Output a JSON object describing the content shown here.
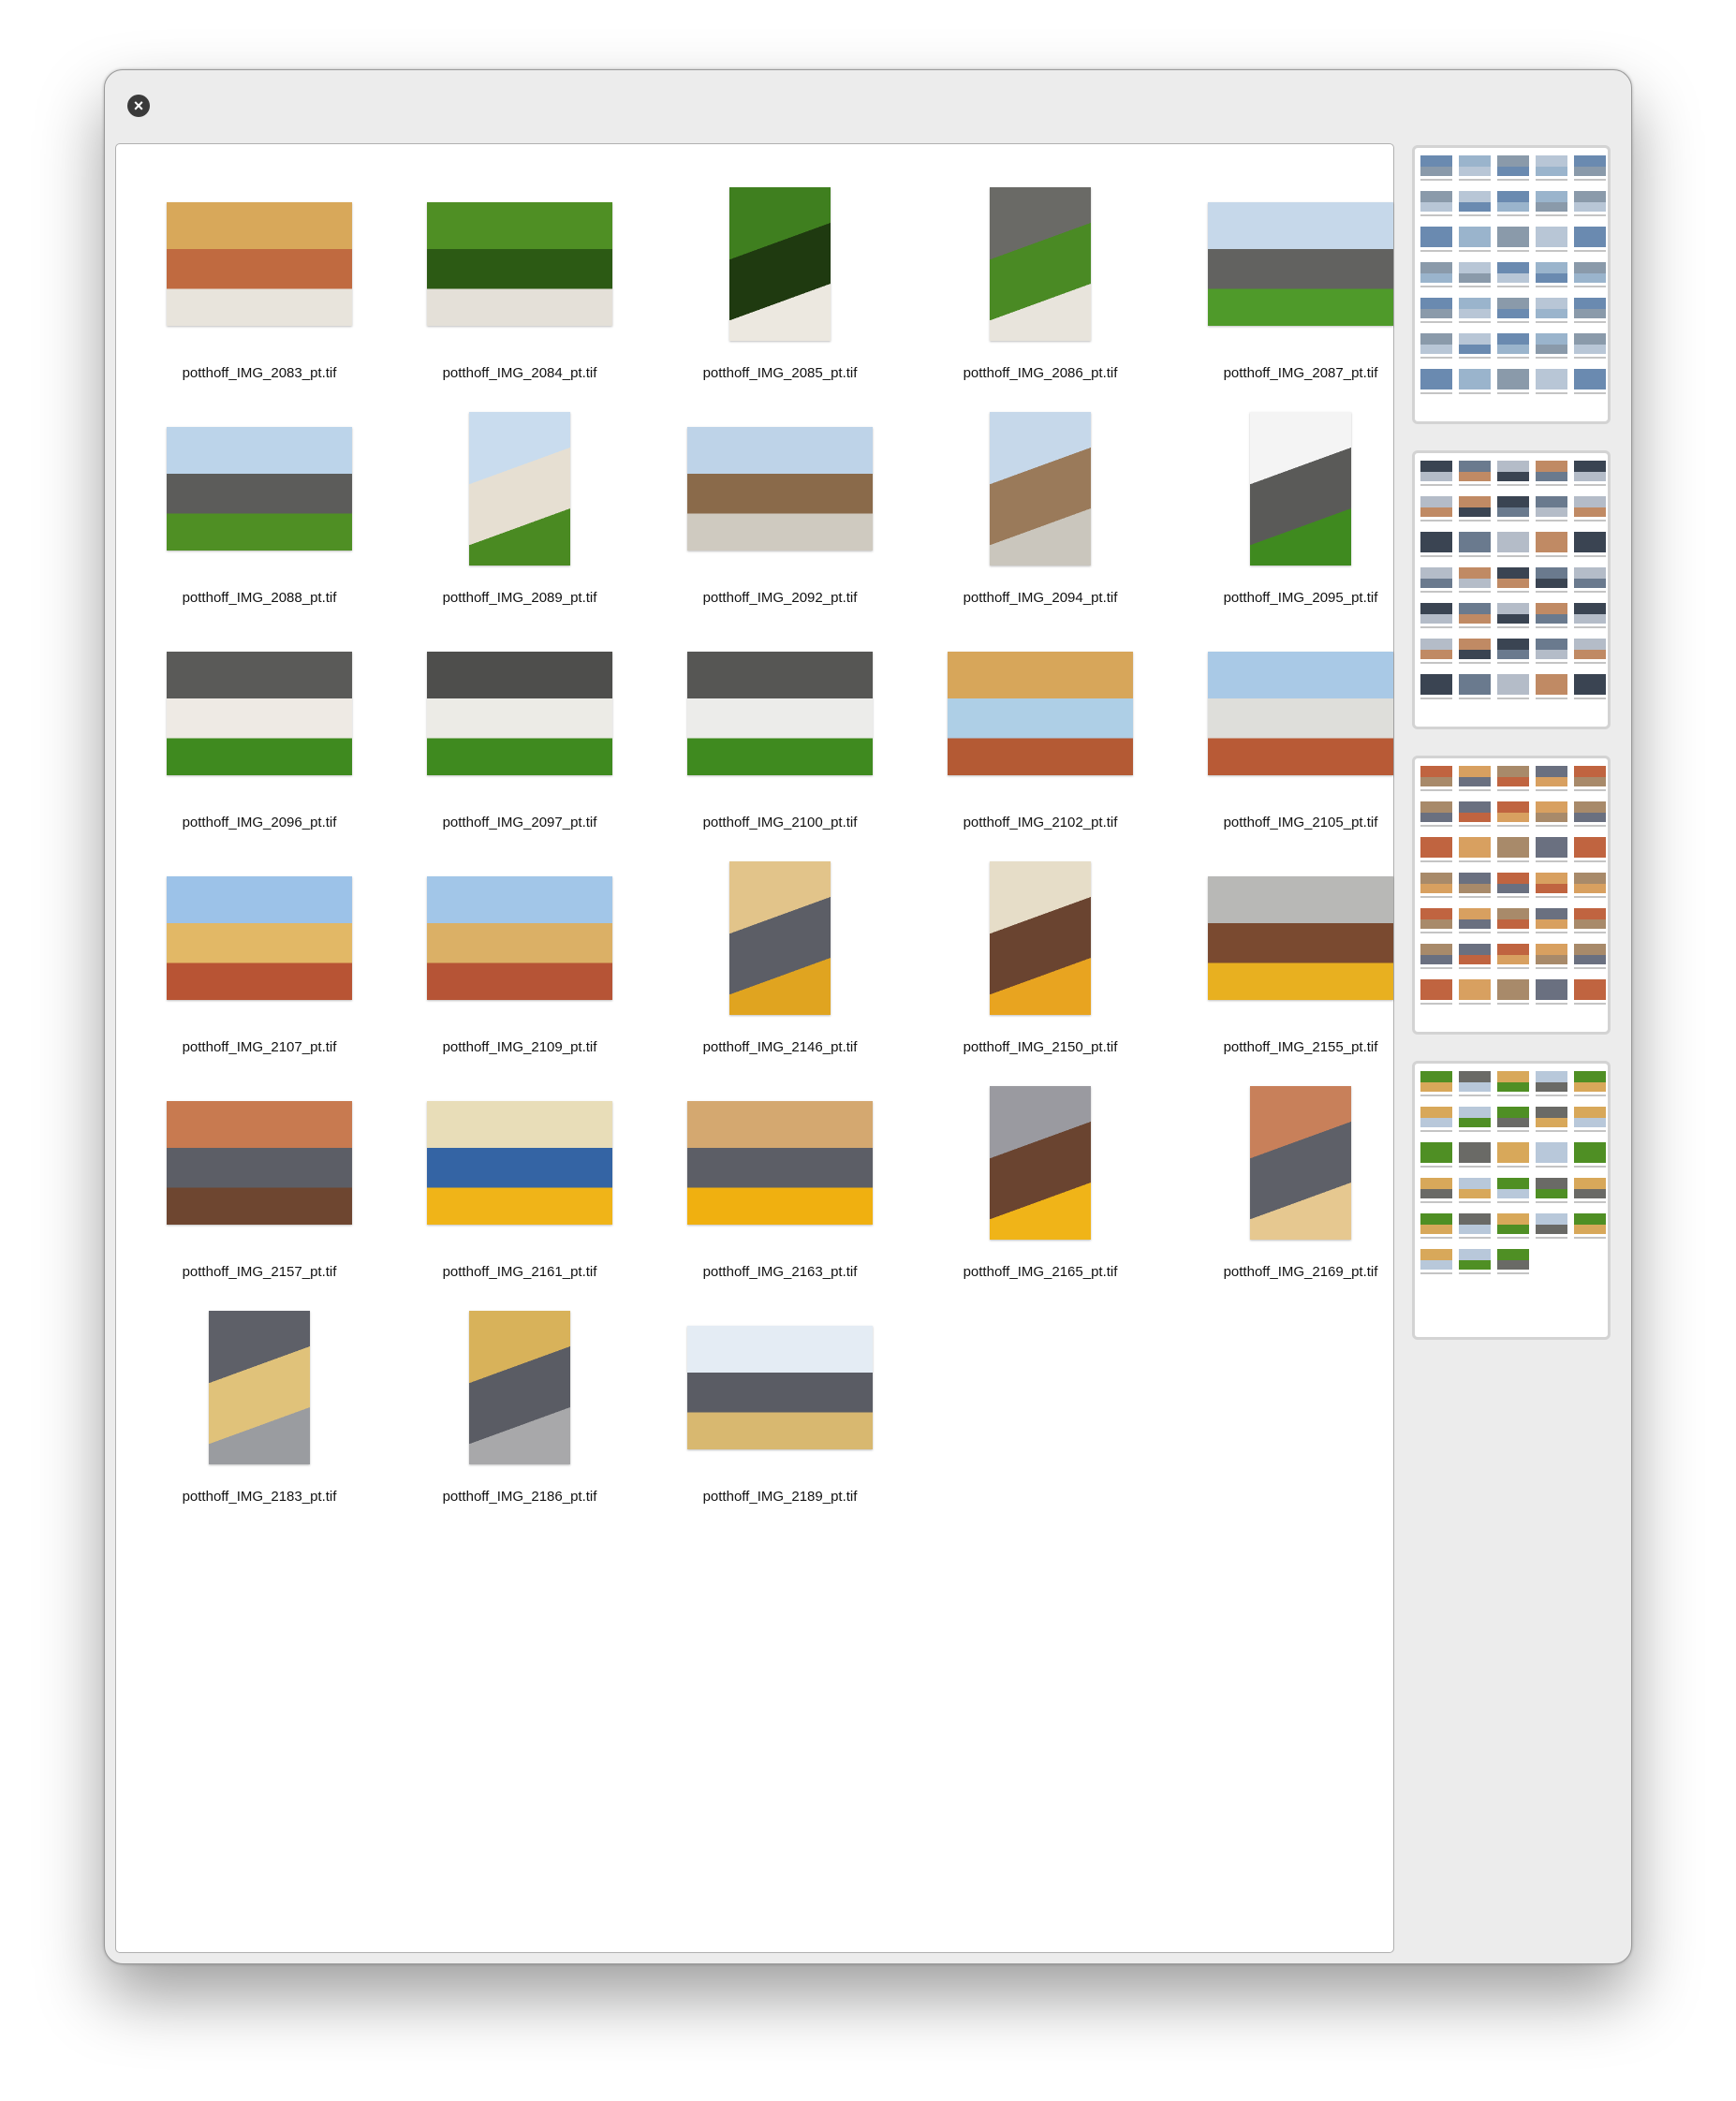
{
  "window": {
    "close_icon": "close-x-icon"
  },
  "images": [
    {
      "name": "potthoff_IMG_2083_pt.tif",
      "orientation": "l",
      "colors": [
        "#d8a85a",
        "#c06a40",
        "#e8e4dc"
      ]
    },
    {
      "name": "potthoff_IMG_2084_pt.tif",
      "orientation": "l",
      "colors": [
        "#4f8f24",
        "#2c5a14",
        "#e4e0d8"
      ]
    },
    {
      "name": "potthoff_IMG_2085_pt.tif",
      "orientation": "p",
      "colors": [
        "#3f7f1f",
        "#1f3a10",
        "#ece8e0"
      ]
    },
    {
      "name": "potthoff_IMG_2086_pt.tif",
      "orientation": "p",
      "colors": [
        "#6a6a66",
        "#4a8a24",
        "#e8e4dc"
      ]
    },
    {
      "name": "potthoff_IMG_2087_pt.tif",
      "orientation": "l",
      "colors": [
        "#c6d8ea",
        "#626260",
        "#4f9a2a"
      ]
    },
    {
      "name": "potthoff_IMG_2088_pt.tif",
      "orientation": "l",
      "colors": [
        "#bcd4ea",
        "#5c5c5a",
        "#4f8f24"
      ]
    },
    {
      "name": "potthoff_IMG_2089_pt.tif",
      "orientation": "p",
      "colors": [
        "#c9dcee",
        "#e6dfd2",
        "#4a8a22"
      ]
    },
    {
      "name": "potthoff_IMG_2092_pt.tif",
      "orientation": "l",
      "colors": [
        "#bed3e8",
        "#8a6a4a",
        "#cfcac0"
      ]
    },
    {
      "name": "potthoff_IMG_2094_pt.tif",
      "orientation": "p",
      "colors": [
        "#c6d8ea",
        "#9a7a5a",
        "#cac6bd"
      ]
    },
    {
      "name": "potthoff_IMG_2095_pt.tif",
      "orientation": "p",
      "colors": [
        "#f4f4f4",
        "#5a5a58",
        "#3f8a1f"
      ]
    },
    {
      "name": "potthoff_IMG_2096_pt.tif",
      "orientation": "l",
      "colors": [
        "#5a5a58",
        "#eeeae4",
        "#3f8a1f"
      ]
    },
    {
      "name": "potthoff_IMG_2097_pt.tif",
      "orientation": "l",
      "colors": [
        "#4e4e4c",
        "#ecebe6",
        "#3f8a1f"
      ]
    },
    {
      "name": "potthoff_IMG_2100_pt.tif",
      "orientation": "l",
      "colors": [
        "#565654",
        "#ececea",
        "#3f8a1f"
      ]
    },
    {
      "name": "potthoff_IMG_2102_pt.tif",
      "orientation": "l",
      "colors": [
        "#d7a65a",
        "#aecfe6",
        "#b45a34"
      ]
    },
    {
      "name": "potthoff_IMG_2105_pt.tif",
      "orientation": "l",
      "colors": [
        "#a9c9e6",
        "#dededa",
        "#b85a36"
      ]
    },
    {
      "name": "potthoff_IMG_2107_pt.tif",
      "orientation": "l",
      "colors": [
        "#9cc2e8",
        "#e2b866",
        "#b85434"
      ]
    },
    {
      "name": "potthoff_IMG_2109_pt.tif",
      "orientation": "l",
      "colors": [
        "#a2c6e8",
        "#dbb066",
        "#b65436"
      ]
    },
    {
      "name": "potthoff_IMG_2146_pt.tif",
      "orientation": "p",
      "colors": [
        "#e2c48a",
        "#5c5e66",
        "#e0a420"
      ]
    },
    {
      "name": "potthoff_IMG_2150_pt.tif",
      "orientation": "p",
      "colors": [
        "#e6ddc8",
        "#6a4430",
        "#e8a420"
      ]
    },
    {
      "name": "potthoff_IMG_2155_pt.tif",
      "orientation": "l",
      "colors": [
        "#b8b8b6",
        "#7a4a30",
        "#e8b020"
      ]
    },
    {
      "name": "potthoff_IMG_2157_pt.tif",
      "orientation": "l",
      "colors": [
        "#c87a50",
        "#5c5e66",
        "#6e4630"
      ]
    },
    {
      "name": "potthoff_IMG_2161_pt.tif",
      "orientation": "l",
      "colors": [
        "#e8ddb8",
        "#3464a4",
        "#f0b418"
      ]
    },
    {
      "name": "potthoff_IMG_2163_pt.tif",
      "orientation": "l",
      "colors": [
        "#d4a870",
        "#5c5e66",
        "#f0b010"
      ]
    },
    {
      "name": "potthoff_IMG_2165_pt.tif",
      "orientation": "p",
      "colors": [
        "#9a9aa0",
        "#6a4430",
        "#f0b418"
      ]
    },
    {
      "name": "potthoff_IMG_2169_pt.tif",
      "orientation": "p",
      "colors": [
        "#c8805a",
        "#5e6068",
        "#e6c890"
      ]
    },
    {
      "name": "potthoff_IMG_2183_pt.tif",
      "orientation": "p",
      "colors": [
        "#5e6068",
        "#e0c27a",
        "#9a9ca0"
      ]
    },
    {
      "name": "potthoff_IMG_2186_pt.tif",
      "orientation": "p",
      "colors": [
        "#d8b25a",
        "#5a5c64",
        "#a8a8aa"
      ]
    },
    {
      "name": "potthoff_IMG_2189_pt.tif",
      "orientation": "l",
      "colors": [
        "#e4ecf4",
        "#5a5c64",
        "#d8b870"
      ]
    }
  ],
  "sidebar": {
    "pages": [
      {
        "count": 35,
        "colors": [
          "#6a8ab0",
          "#9ab4cc",
          "#8a9aaa",
          "#b8c6d6"
        ]
      },
      {
        "count": 35,
        "colors": [
          "#3a4452",
          "#6a7a8e",
          "#b4bcc8",
          "#c08a64"
        ]
      },
      {
        "count": 35,
        "colors": [
          "#c06440",
          "#d8a060",
          "#a88a6a",
          "#6a7080"
        ]
      },
      {
        "count": 28,
        "colors": [
          "#4f8f24",
          "#6a6a66",
          "#d8a85a",
          "#b8c8da"
        ]
      }
    ]
  }
}
